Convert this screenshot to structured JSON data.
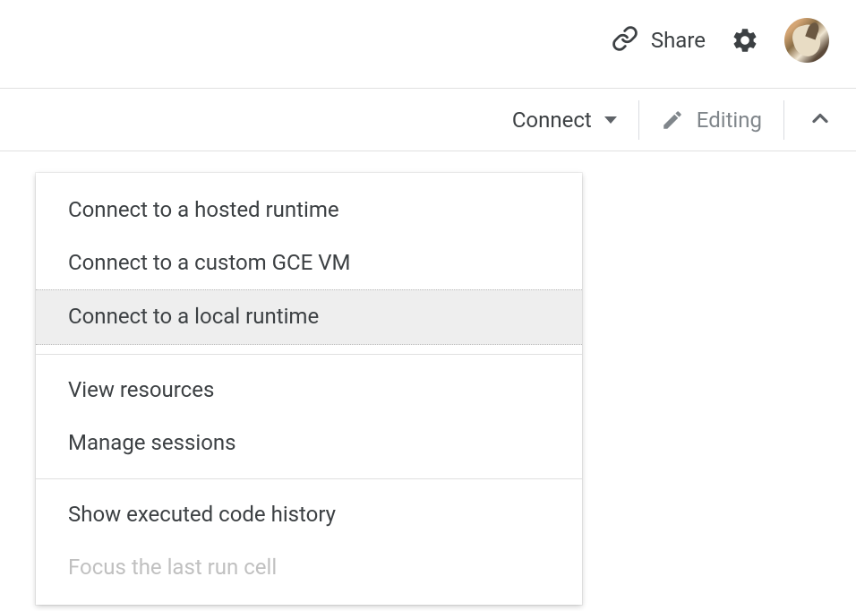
{
  "header": {
    "share_label": "Share"
  },
  "toolbar": {
    "connect_label": "Connect",
    "editing_label": "Editing"
  },
  "menu": {
    "items": [
      {
        "label": "Connect to a hosted runtime",
        "state": "normal"
      },
      {
        "label": "Connect to a custom GCE VM",
        "state": "normal"
      },
      {
        "label": "Connect to a local runtime",
        "state": "hover"
      },
      {
        "label": "View resources",
        "state": "normal"
      },
      {
        "label": "Manage sessions",
        "state": "normal"
      },
      {
        "label": "Show executed code history",
        "state": "normal"
      },
      {
        "label": "Focus the last run cell",
        "state": "disabled"
      }
    ]
  }
}
